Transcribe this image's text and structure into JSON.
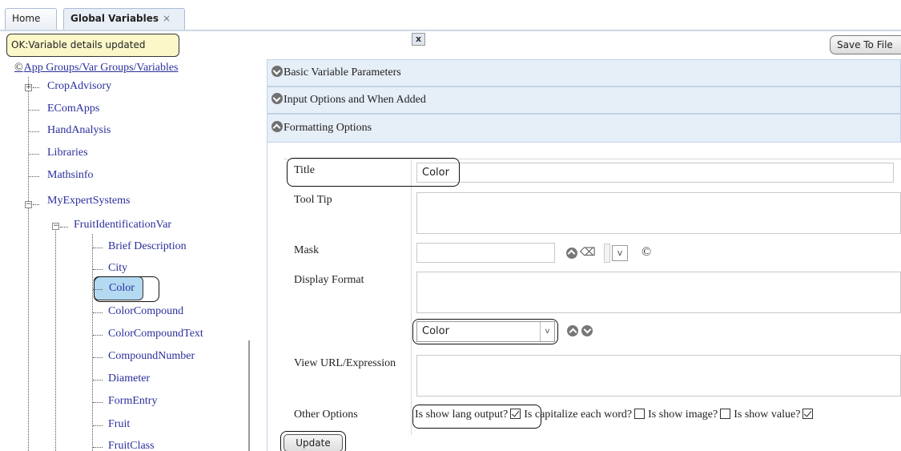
{
  "tabs": [
    {
      "label": "Home"
    },
    {
      "label": "Global Variables",
      "close": "×"
    }
  ],
  "status": {
    "message": "OK:Variable details updated",
    "close": "x"
  },
  "toolbar": {
    "save_label": "Save To File"
  },
  "tree": {
    "root_icon": "©",
    "root_label": "App Groups/Var Groups/Variables",
    "groups": [
      "CropAdvisory",
      "EComApps",
      "HandAnalysis",
      "Libraries",
      "Mathsinfo",
      "MyExpertSystems"
    ],
    "subgroup": "FruitIdentificationVar",
    "variables": [
      "Brief Description",
      "City",
      "Color",
      "ColorCompound",
      "ColorCompoundText",
      "CompoundNumber",
      "Diameter",
      "FormEntry",
      "Fruit",
      "FruitClass"
    ],
    "selected": "Color"
  },
  "accordion": {
    "basic": "Basic Variable Parameters",
    "input": "Input Options and When Added",
    "formatting": "Formatting Options"
  },
  "form": {
    "title_label": "Title",
    "title_value": "Color",
    "tooltip_label": "Tool Tip",
    "mask_label": "Mask",
    "mask_value": "",
    "display_format_label": "Display Format",
    "display_variable": "Color",
    "view_url_label": "View URL/Expression",
    "other_options_label": "Other Options",
    "options": [
      {
        "label": "Is show lang output?",
        "checked": true
      },
      {
        "label": "Is capitalize each word?",
        "checked": false
      },
      {
        "label": "Is show image?",
        "checked": false
      },
      {
        "label": "Is show value?",
        "checked": true
      }
    ],
    "update_label": "Update"
  },
  "icons": {
    "mask_clear": "⌫",
    "dropdown": "v",
    "refresh": "©"
  }
}
